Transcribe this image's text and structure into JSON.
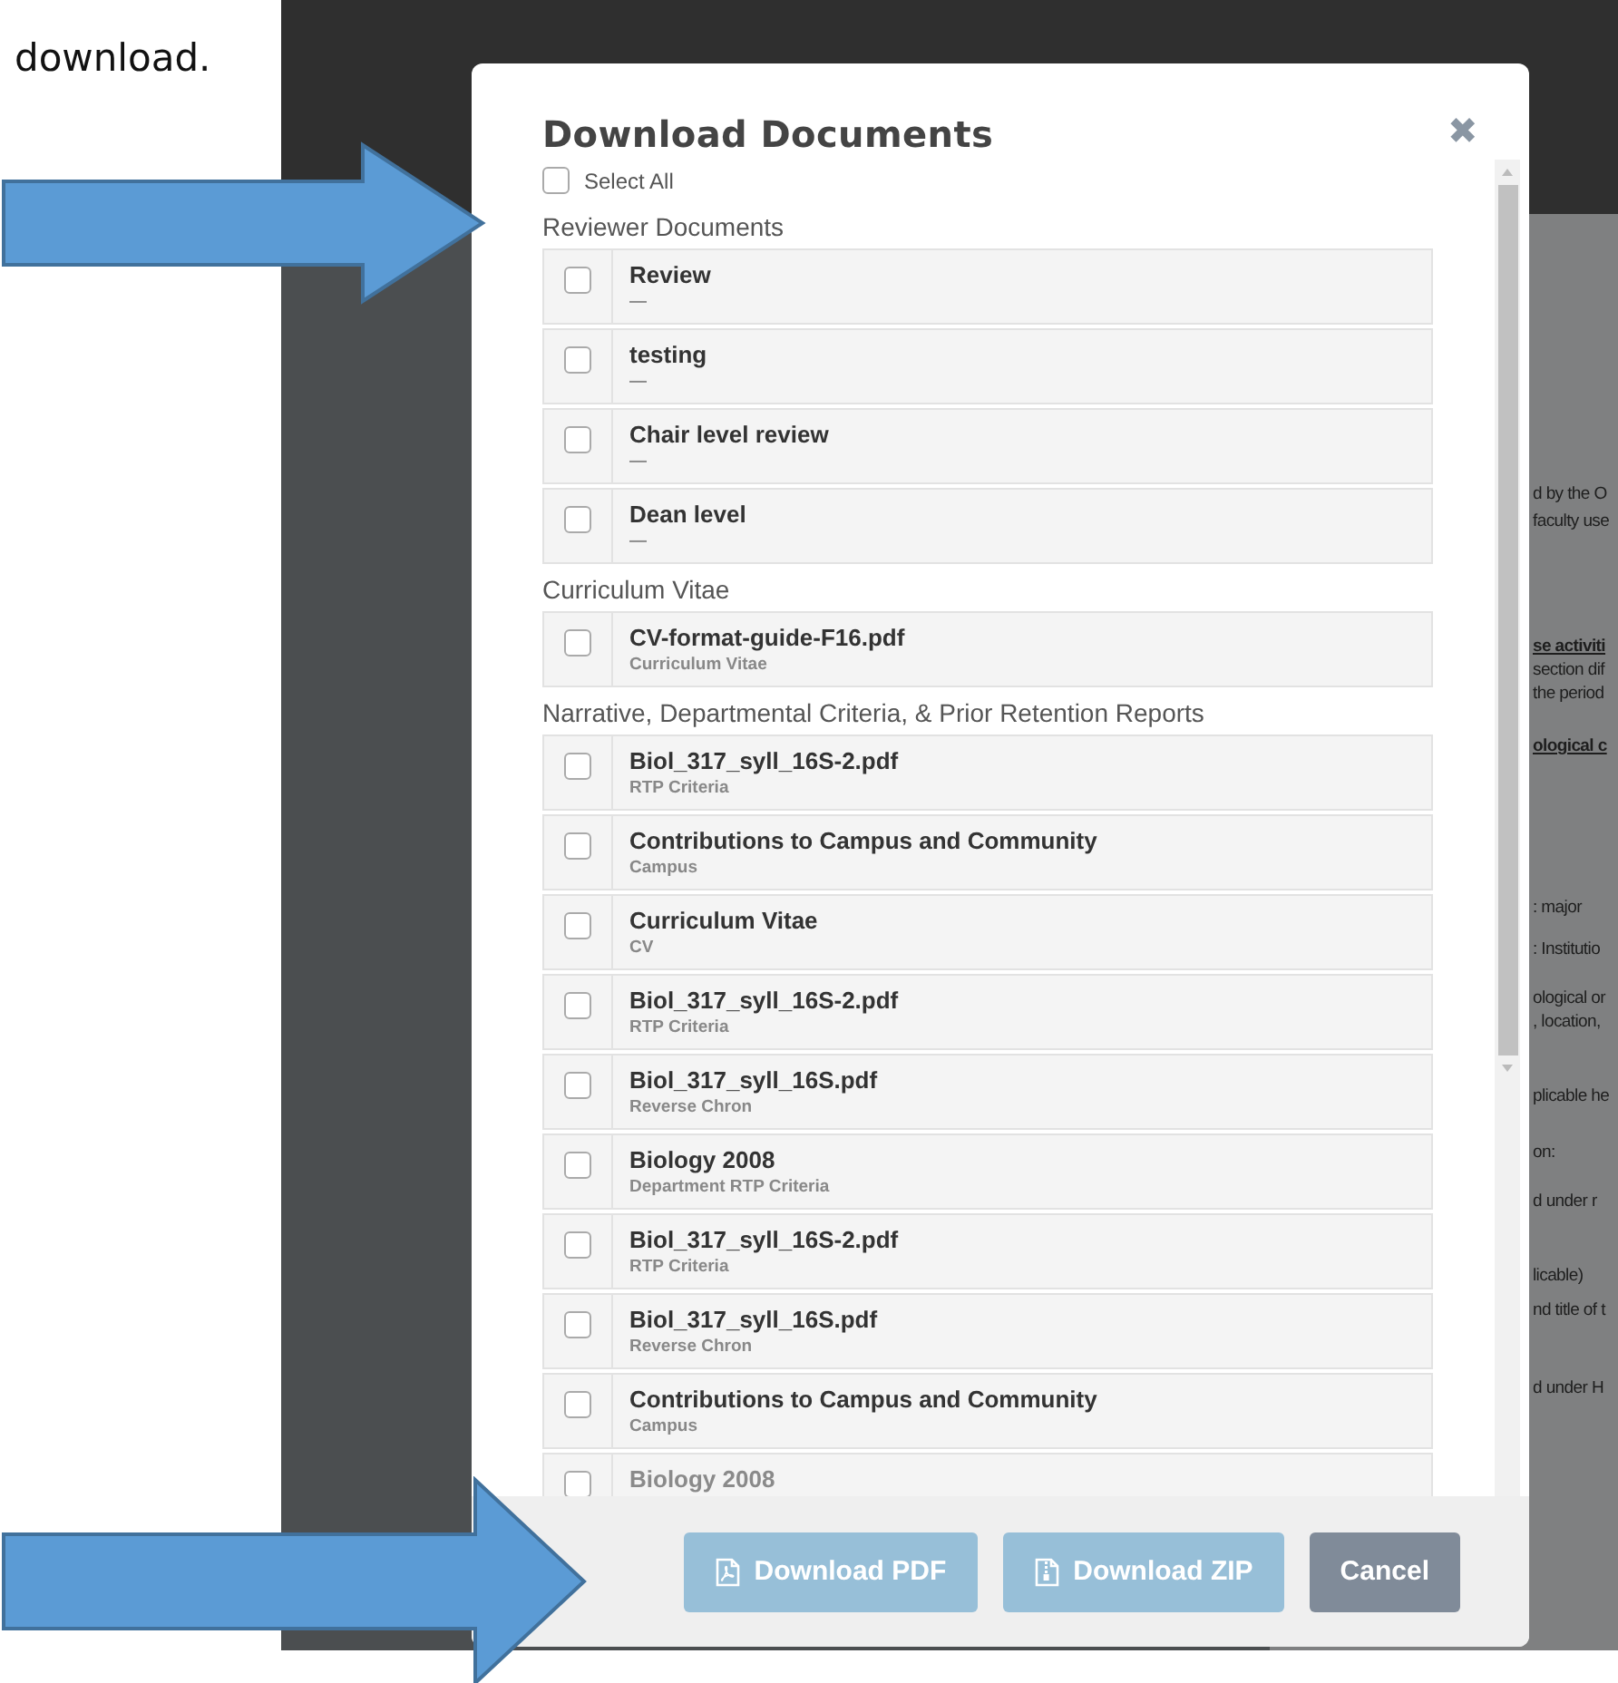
{
  "caption": "download.",
  "background_document": {
    "lines": [
      {
        "text": "d by the O",
        "kind": "plain"
      },
      {
        "text": "faculty use",
        "kind": "plain"
      },
      {
        "text": "se activiti",
        "kind": "heading"
      },
      {
        "text": "section dif",
        "kind": "plain"
      },
      {
        "text": "the period",
        "kind": "plain"
      },
      {
        "text": "ological c",
        "kind": "heading"
      },
      {
        "text": ": major",
        "kind": "plain"
      },
      {
        "text": ":  Institutio",
        "kind": "plain"
      },
      {
        "text": "ological or",
        "kind": "plain"
      },
      {
        "text": ", location,",
        "kind": "plain"
      },
      {
        "text": "plicable he",
        "kind": "plain"
      },
      {
        "text": "on:",
        "kind": "plain"
      },
      {
        "text": "d under r",
        "kind": "plain"
      },
      {
        "text": "licable)",
        "kind": "plain"
      },
      {
        "text": "nd title of t",
        "kind": "plain"
      },
      {
        "text": "d under H",
        "kind": "plain"
      }
    ]
  },
  "dialog": {
    "title": "Download Documents",
    "close": "✖",
    "select_all": {
      "label": "Select All",
      "checked": false
    },
    "sections": [
      {
        "heading": "Reviewer Documents",
        "items": [
          {
            "title": "Review",
            "subtitle": "—",
            "checked": false
          },
          {
            "title": "testing",
            "subtitle": "—",
            "checked": false
          },
          {
            "title": "Chair level review",
            "subtitle": "—",
            "checked": false
          },
          {
            "title": "Dean level",
            "subtitle": "—",
            "checked": false
          }
        ]
      },
      {
        "heading": "Curriculum Vitae",
        "items": [
          {
            "title": "CV-format-guide-F16.pdf",
            "subtitle": "Curriculum Vitae",
            "checked": false
          }
        ]
      },
      {
        "heading": "Narrative, Departmental Criteria, & Prior Retention Reports",
        "items": [
          {
            "title": "Biol_317_syll_16S-2.pdf",
            "subtitle": "RTP Criteria",
            "checked": false
          },
          {
            "title": "Contributions to Campus and Community",
            "subtitle": "Campus",
            "checked": false
          },
          {
            "title": "Curriculum Vitae",
            "subtitle": "CV",
            "checked": false
          },
          {
            "title": "Biol_317_syll_16S-2.pdf",
            "subtitle": "RTP Criteria",
            "checked": false
          },
          {
            "title": "Biol_317_syll_16S.pdf",
            "subtitle": "Reverse Chron",
            "checked": false
          },
          {
            "title": "Biology 2008",
            "subtitle": "Department RTP Criteria",
            "checked": false
          },
          {
            "title": "Biol_317_syll_16S-2.pdf",
            "subtitle": "RTP Criteria",
            "checked": false
          },
          {
            "title": "Biol_317_syll_16S.pdf",
            "subtitle": "Reverse Chron",
            "checked": false
          },
          {
            "title": "Contributions to Campus and Community",
            "subtitle": "Campus",
            "checked": false
          },
          {
            "title": "Biology 2008",
            "checked": false
          }
        ]
      }
    ],
    "buttons": [
      {
        "label": "Download PDF",
        "kind": "pdf",
        "disabled": true
      },
      {
        "label": "Download ZIP",
        "kind": "zip",
        "disabled": true
      },
      {
        "label": "Cancel",
        "kind": "cancel",
        "disabled": false
      }
    ]
  }
}
